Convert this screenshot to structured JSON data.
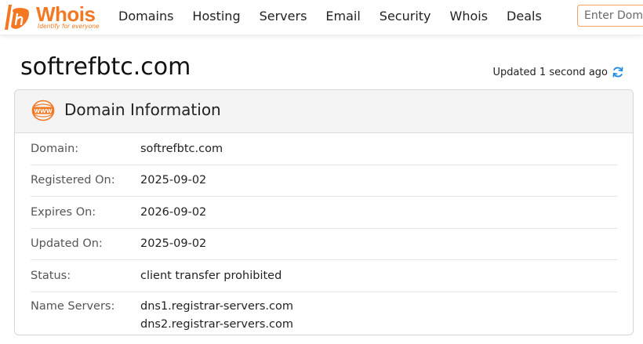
{
  "header": {
    "logo_text": "Whois",
    "logo_tagline": "Identify for everyone",
    "nav": [
      "Domains",
      "Hosting",
      "Servers",
      "Email",
      "Security",
      "Whois",
      "Deals"
    ],
    "search_placeholder": "Enter Domain"
  },
  "page": {
    "title": "softrefbtc.com",
    "updated_text": "Updated 1 second ago"
  },
  "card": {
    "title": "Domain Information",
    "icon_label": "WWW",
    "rows": [
      {
        "key": "Domain:",
        "value": "softrefbtc.com"
      },
      {
        "key": "Registered On:",
        "value": "2025-09-02"
      },
      {
        "key": "Expires On:",
        "value": "2026-09-02"
      },
      {
        "key": "Updated On:",
        "value": "2025-09-02"
      },
      {
        "key": "Status:",
        "value": "client transfer prohibited"
      }
    ],
    "name_servers_key": "Name Servers:",
    "name_servers": [
      "dns1.registrar-servers.com",
      "dns2.registrar-servers.com"
    ]
  },
  "colors": {
    "brand": "#f37821",
    "refresh": "#1e88e5"
  }
}
